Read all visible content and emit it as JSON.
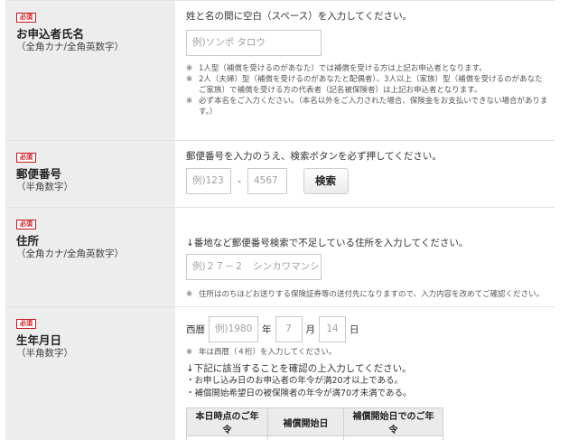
{
  "required_label": "必須",
  "name_row": {
    "title": "お申込者氏名",
    "sub": "（全角カナ/全角英数字）",
    "instruction": "姓と名の間に空白（スペース）を入力してください。",
    "placeholder": "例)ソンポ タロウ",
    "notes": [
      [
        "1人型（補償を受けるのがあなた）では補償を受ける方は上記お申込者となります。"
      ],
      [
        "2人（夫婦）型（補償を受けるのがあなたと配偶者）、3人以上（家族）型（補償を受けるのがあなた",
        "ご家族）で補償を受ける方の代表者（記名被保険者）は上記お申込者となります。"
      ],
      [
        "必ず本名をご入力ください。（本名以外をご入力された場合、保険金をお支払いできない場合がありま",
        "す。）"
      ]
    ]
  },
  "postal_row": {
    "title": "郵便番号",
    "sub": "（半角数字）",
    "instruction": "郵便番号を入力のうえ、検索ボタンを必ず押してください。",
    "placeholder1": "例)123",
    "placeholder2": "4567",
    "separator": "-",
    "search_label": "検索"
  },
  "address_row": {
    "title": "住所",
    "sub": "（全角カナ/全角英数字）",
    "instruction": "↓番地など郵便番号検索で不足している住所を入力してください。",
    "placeholder": "例)２７－２　シンカワマンション",
    "note": "住所はのちほどお送りする保険証券等の送付先になりますので、入力内容を改めてご確認ください。"
  },
  "birth_row": {
    "title": "生年月日",
    "sub": "（半角数字）",
    "era_label": "西暦",
    "year_placeholder": "例)1980",
    "year_unit": "年",
    "month_placeholder": "7",
    "month_unit": "月",
    "day_placeholder": "14",
    "day_unit": "日",
    "note": "年は西暦（４桁）を入力してください。",
    "confirm_instruction": "↓下記に該当することを確認の上入力してください。",
    "conditions": [
      "・お申し込み日のお申込者の年令が満20才以上である。",
      "・補償開始希望日の被保険者の年令が満70才未満である。"
    ],
    "table_headers": [
      "本日時点のご年令",
      "補償開始日",
      "補償開始日でのご年令"
    ]
  },
  "mark": "※"
}
